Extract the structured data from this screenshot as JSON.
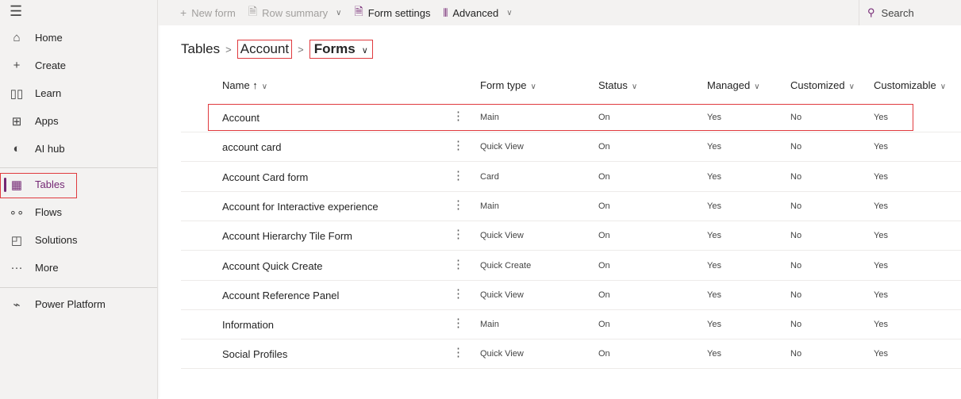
{
  "sidebar": {
    "items": [
      {
        "label": "Home",
        "icon": "home-icon",
        "glyph": "⌂"
      },
      {
        "label": "Create",
        "icon": "plus-icon",
        "glyph": "+"
      },
      {
        "label": "Learn",
        "icon": "book-icon",
        "glyph": "▯▯"
      },
      {
        "label": "Apps",
        "icon": "apps-icon",
        "glyph": "⊞"
      },
      {
        "label": "AI hub",
        "icon": "brain-icon",
        "glyph": "◐"
      },
      {
        "label": "Tables",
        "icon": "table-grid-icon",
        "glyph": "▦"
      },
      {
        "label": "Flows",
        "icon": "flow-icon",
        "glyph": "∘∘"
      },
      {
        "label": "Solutions",
        "icon": "solutions-icon",
        "glyph": "◰"
      },
      {
        "label": "More",
        "icon": "more-icon",
        "glyph": "···"
      },
      {
        "label": "Power Platform",
        "icon": "power-platform-icon",
        "glyph": "⌁"
      }
    ],
    "active": "Tables"
  },
  "toolbar": {
    "new_form": "New form",
    "row_summary": "Row summary",
    "form_settings": "Form settings",
    "advanced": "Advanced",
    "search": "Search"
  },
  "breadcrumb": {
    "tables": "Tables",
    "account": "Account",
    "forms": "Forms"
  },
  "table": {
    "headers": {
      "name": "Name ↑",
      "form_type": "Form type",
      "status": "Status",
      "managed": "Managed",
      "customized": "Customized",
      "customizable": "Customizable"
    },
    "rows": [
      {
        "name": "Account",
        "form_type": "Main",
        "status": "On",
        "managed": "Yes",
        "customized": "No",
        "customizable": "Yes"
      },
      {
        "name": "account card",
        "form_type": "Quick View",
        "status": "On",
        "managed": "Yes",
        "customized": "No",
        "customizable": "Yes"
      },
      {
        "name": "Account Card form",
        "form_type": "Card",
        "status": "On",
        "managed": "Yes",
        "customized": "No",
        "customizable": "Yes"
      },
      {
        "name": "Account for Interactive experience",
        "form_type": "Main",
        "status": "On",
        "managed": "Yes",
        "customized": "No",
        "customizable": "Yes"
      },
      {
        "name": "Account Hierarchy Tile Form",
        "form_type": "Quick View",
        "status": "On",
        "managed": "Yes",
        "customized": "No",
        "customizable": "Yes"
      },
      {
        "name": "Account Quick Create",
        "form_type": "Quick Create",
        "status": "On",
        "managed": "Yes",
        "customized": "No",
        "customizable": "Yes"
      },
      {
        "name": "Account Reference Panel",
        "form_type": "Quick View",
        "status": "On",
        "managed": "Yes",
        "customized": "No",
        "customizable": "Yes"
      },
      {
        "name": "Information",
        "form_type": "Main",
        "status": "On",
        "managed": "Yes",
        "customized": "No",
        "customizable": "Yes"
      },
      {
        "name": "Social Profiles",
        "form_type": "Quick View",
        "status": "On",
        "managed": "Yes",
        "customized": "No",
        "customizable": "Yes"
      }
    ]
  },
  "colors": {
    "accent": "#742774",
    "highlight": "#e03a3e"
  }
}
